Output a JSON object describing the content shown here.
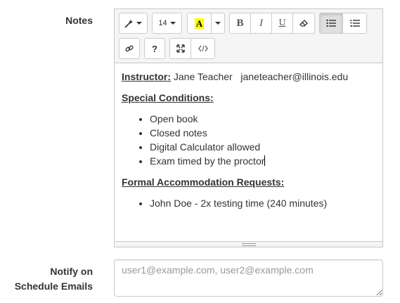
{
  "notes": {
    "label": "Notes",
    "toolbar": {
      "font_size": "14",
      "highlight_letter": "A",
      "bold": "B",
      "italic": "I",
      "underline": "U",
      "help": "?"
    },
    "content": {
      "instructor_label": "Instructor:",
      "instructor_value": " Jane Teacher   janeteacher@illinois.edu",
      "special_heading": "Special Conditions:",
      "special_items": [
        "Open book",
        "Closed notes",
        "Digital Calculator allowed",
        "Exam timed by the proctor"
      ],
      "formal_heading": "Formal Accommodation Requests:",
      "formal_items": [
        "John Doe - 2x testing time (240 minutes)"
      ]
    }
  },
  "notify": {
    "label_line1": "Notify on",
    "label_line2": "Schedule Emails",
    "placeholder": "user1@example.com, user2@example.com"
  }
}
